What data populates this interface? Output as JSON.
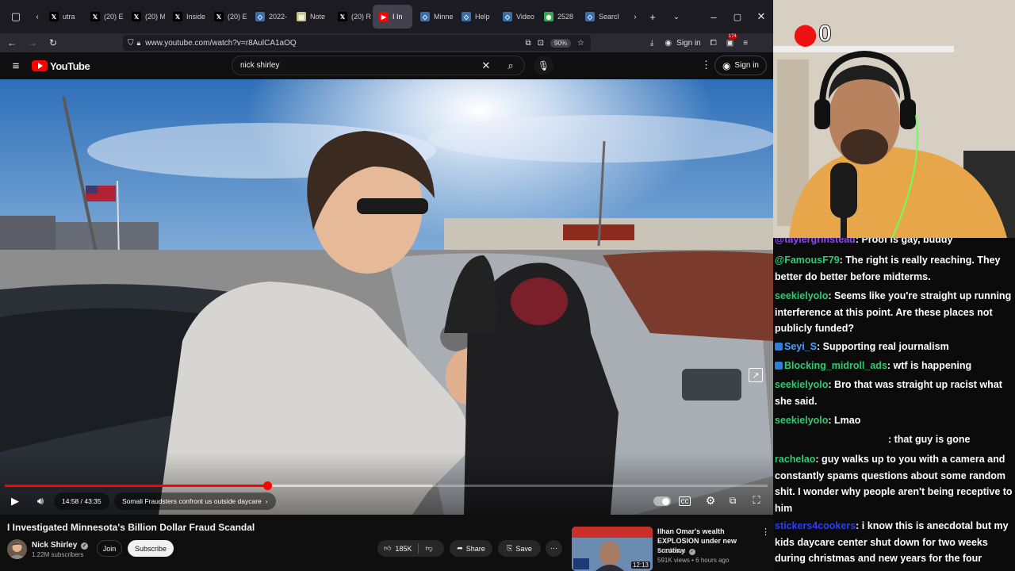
{
  "browser": {
    "tabs": [
      {
        "label": "utra",
        "icon": "x-logo-icon"
      },
      {
        "label": "(20) E",
        "icon": "x-logo-icon"
      },
      {
        "label": "(20) M",
        "icon": "x-logo-icon"
      },
      {
        "label": "Inside",
        "icon": "x-logo-icon"
      },
      {
        "label": "(20) E",
        "icon": "x-logo-icon"
      },
      {
        "label": "2022-",
        "icon": "page-icon"
      },
      {
        "label": "Note",
        "icon": "note-icon"
      },
      {
        "label": "(20) R",
        "icon": "x-logo-icon"
      },
      {
        "label": "I In",
        "icon": "youtube-icon"
      },
      {
        "label": "Minne",
        "icon": "page-icon"
      },
      {
        "label": "Help",
        "icon": "page-icon"
      },
      {
        "label": "Video",
        "icon": "page-icon"
      },
      {
        "label": "2528",
        "icon": "map-icon"
      },
      {
        "label": "Search",
        "icon": "page-icon"
      }
    ],
    "url": "www.youtube.com/watch?v=r8AulCA1aOQ",
    "zoom": "90%",
    "signin_label": "Sign in",
    "ext_badge": "174"
  },
  "youtube": {
    "logo_text": "YouTube",
    "search_value": "nick shirley",
    "signin_label": "Sign in"
  },
  "player": {
    "time": "14:58 / 43:35",
    "chapter": "Somali Fraudsters confront us outside daycare",
    "progress": 0.344,
    "buffered": 0.56
  },
  "video_info": {
    "title": "I Investigated Minnesota's Billion Dollar Fraud Scandal",
    "channel": "Nick Shirley",
    "subscribers": "1.22M subscribers",
    "join_label": "Join",
    "subscribe_label": "Subscribe",
    "likes": "185K",
    "share_label": "Share",
    "save_label": "Save"
  },
  "recommendation": {
    "title": "Ilhan Omar's wealth EXPLOSION under new scrutiny",
    "channel": "Fox News",
    "meta": "591K views • 6 hours ago",
    "duration": "12:13"
  },
  "overlay": {
    "counter": "0"
  },
  "chat": [
    {
      "user": "@taylergrinstead",
      "text": ": Proof is gay, buddy",
      "color": "#9146ff",
      "badge": ""
    },
    {
      "user": "@FamousF79",
      "text": ": The right is really reaching. They better do better before midterms.",
      "color": "#2ecc71",
      "badge": ""
    },
    {
      "user": "seekielyolo",
      "text": ": Seems like you're straight up running interference at this point. Are these places not publicly funded?",
      "color": "#2ecc71",
      "badge": ""
    },
    {
      "user": "Seyi_S",
      "text": ": Supporting real journalism",
      "color": "#4aa3ff",
      "badge": "#2f7fd6"
    },
    {
      "user": "Blocking_midroll_ads",
      "text": ": wtf is happening",
      "color": "#2ecc71",
      "badge": "#2f7fd6"
    },
    {
      "user": "seekielyolo",
      "text": ": Bro that was straight up racist what she said.",
      "color": "#2ecc71",
      "badge": ""
    },
    {
      "user": "seekielyolo",
      "text": ": Lmao",
      "color": "#2ecc71",
      "badge": ""
    },
    {
      "user": "",
      "text": ": that guy is gone",
      "color": "#2ecc71",
      "badge": ""
    },
    {
      "user": "rachelao",
      "text": ": guy walks up to you with a camera and constantly spams questions about some random shit. I wonder why people aren't being receptive to him",
      "color": "#2ecc71",
      "badge": ""
    },
    {
      "user": "stickers4cookers",
      "text": ": i know this is anecdotal but my kids daycare center shut down for two weeks during christmas and new years for the four",
      "color": "#2a3cff",
      "badge": ""
    }
  ]
}
